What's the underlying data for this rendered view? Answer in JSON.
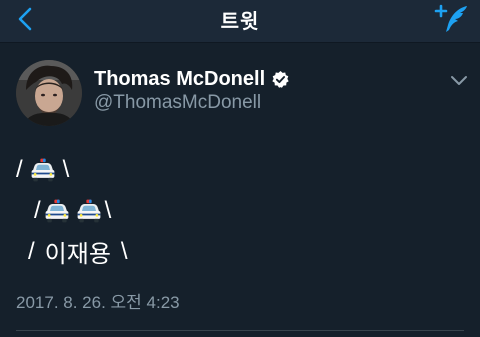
{
  "nav": {
    "title": "트윗",
    "back_icon": "chevron-left-icon",
    "compose_icon": "compose-tweet-icon",
    "accent_color": "#1da1f2"
  },
  "tweet": {
    "author_name": "Thomas McDonell",
    "author_handle": "@ThomasMcDonell",
    "verified": true,
    "lines": [
      {
        "left": "/",
        "right": "\\"
      },
      {
        "left": "/",
        "right": "\\"
      },
      {
        "left": "/",
        "text": "이재용",
        "right": "\\"
      }
    ],
    "emoji": "police-car",
    "timestamp": "2017. 8. 26. 오전 4:23"
  },
  "colors": {
    "background": "#15202b",
    "navbar": "#1c2938",
    "text": "#ffffff",
    "muted": "#8899a6"
  }
}
